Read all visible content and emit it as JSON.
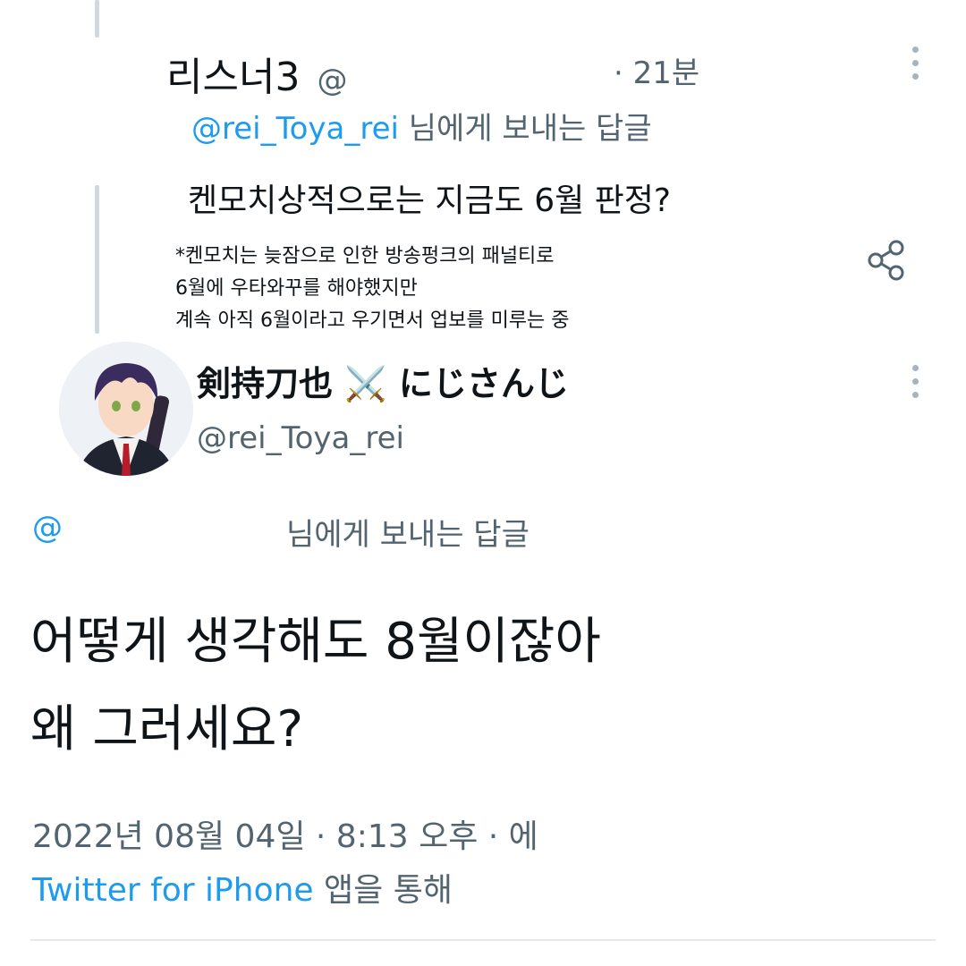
{
  "reply_tweet": {
    "display_name": "리스너3",
    "handle_prefix": "@",
    "time": "· 21분",
    "replying_to_handle": "@rei_Toya_rei",
    "replying_to_suffix": "님에게 보내는 답글",
    "text": "켄모치상적으로는 지금도 6월 판정?",
    "note_lines": [
      "*켄모치는 늦잠으로 인한 방송펑크의 패널티로",
      "6월에 우타와꾸를 해야했지만",
      "계속 아직 6월이라고 우기면서 업보를 미루는 중"
    ]
  },
  "main_tweet": {
    "display_name": "剣持刀也",
    "display_name_suffix": "にじさんじ",
    "name_emoji": "⚔️",
    "handle": "@rei_Toya_rei",
    "replying_to_handle": "@",
    "replying_to_suffix": "님에게 보내는 답글",
    "text_lines": [
      "어떻게 생각해도 8월이잖아",
      "왜 그러세요?"
    ],
    "timestamp": "2022년 08월 04일 · 8:13 오후 · 에",
    "source_app": "Twitter for iPhone",
    "source_suffix": "앱을 통해"
  },
  "colors": {
    "accent_blue": "#1d9bf0",
    "muted_gray": "#536471",
    "thread_line": "#cfd9de",
    "divider": "#e6e9ec"
  },
  "icons": {
    "more_options": "more-vertical-icon",
    "share": "share-icon",
    "name_emoji": "crossed-swords-icon"
  }
}
